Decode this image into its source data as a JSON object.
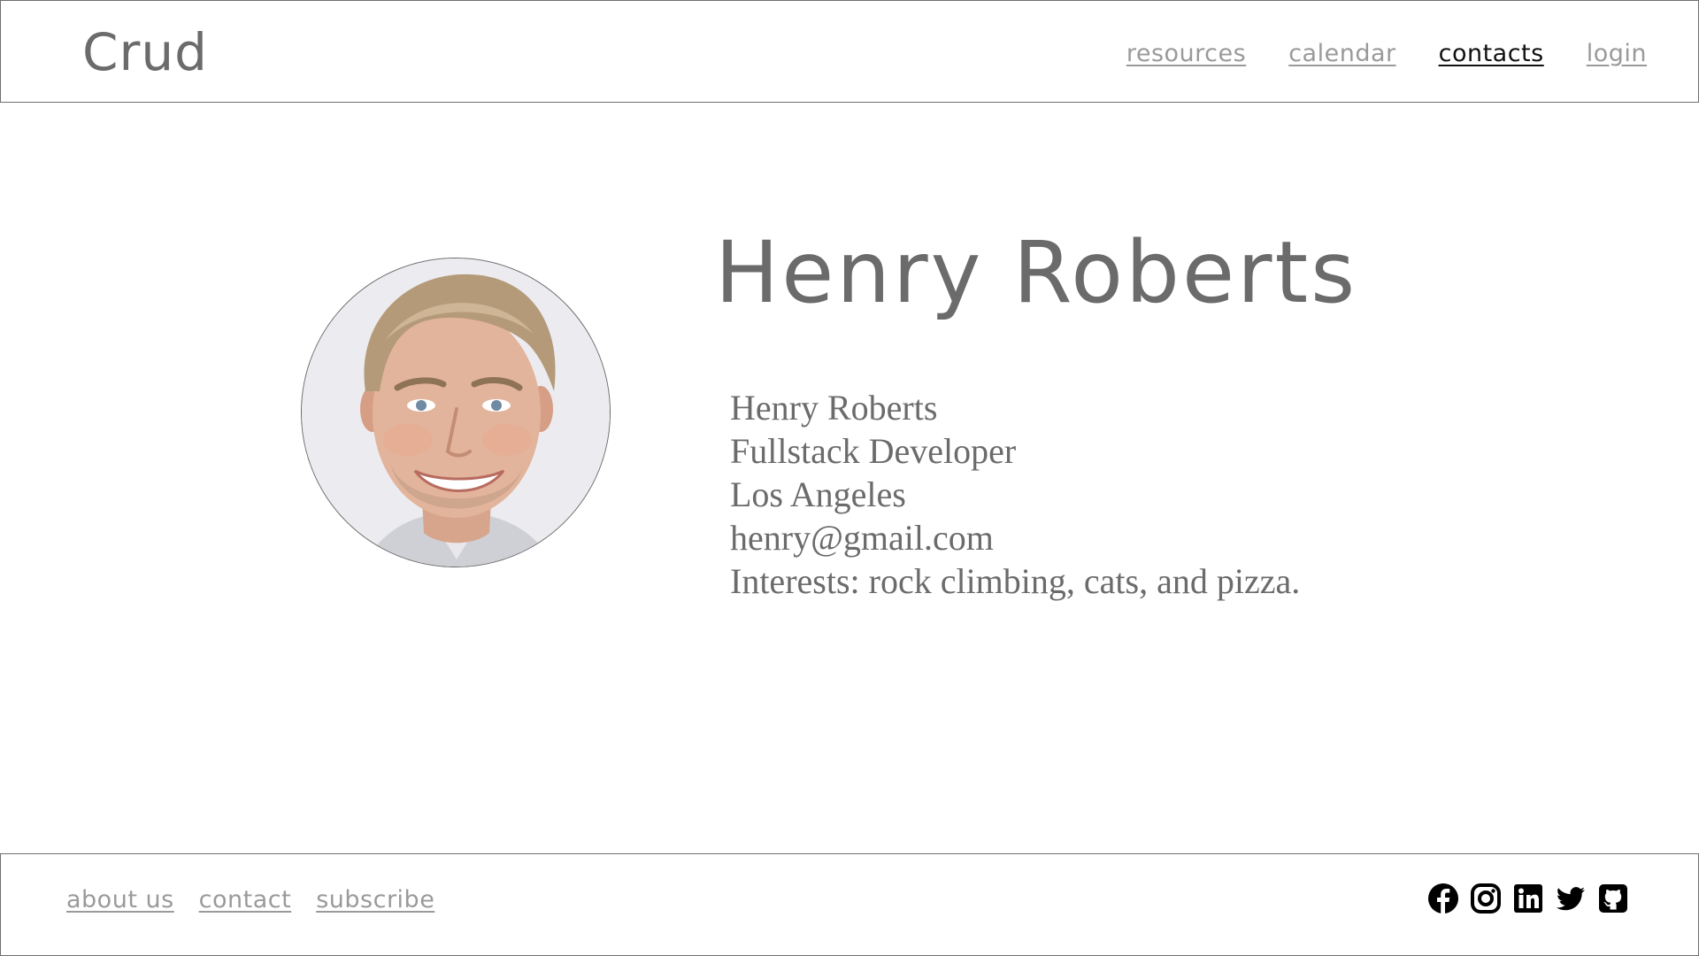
{
  "header": {
    "logo": "Crud",
    "nav": [
      {
        "label": "resources",
        "active": false
      },
      {
        "label": "calendar",
        "active": false
      },
      {
        "label": "contacts",
        "active": true
      },
      {
        "label": "login",
        "active": false
      }
    ]
  },
  "profile": {
    "title": "Henry Roberts",
    "photo_icon": "person-photo",
    "name": "Henry Roberts",
    "role": "Fullstack Developer",
    "location": "Los Angeles",
    "email": "henry@gmail.com",
    "interests": "Interests: rock climbing, cats, and pizza."
  },
  "footer": {
    "links": [
      "about us",
      "contact",
      "subscribe"
    ],
    "social_icons": [
      "facebook-icon",
      "instagram-icon",
      "linkedin-icon",
      "twitter-icon",
      "github-icon"
    ]
  },
  "colors": {
    "text_gray": "#6b6b6b",
    "link_gray": "#9a9a9a",
    "active_link": "#111111",
    "border": "#707070"
  }
}
